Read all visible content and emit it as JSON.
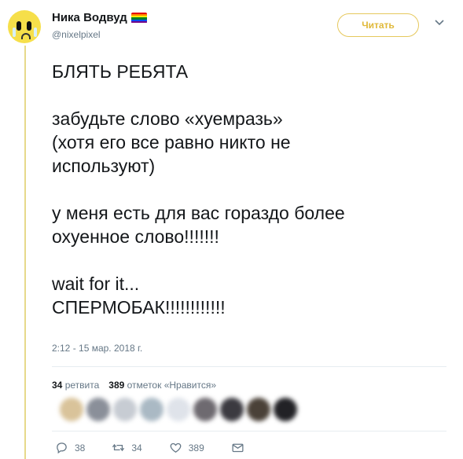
{
  "user": {
    "display_name": "Ника Водвуд",
    "handle": "@nixelpixel",
    "avatar_icon": "yellow-crying-face",
    "flag_icon": "rainbow-flag"
  },
  "header": {
    "follow_label": "Читать",
    "menu_icon": "chevron-down-icon"
  },
  "tweet": {
    "lines": [
      "БЛЯТЬ РЕБЯТА",
      "",
      "забудьте слово «хуемразь»",
      "(хотя его все равно никто не",
      "используют)",
      "",
      "у меня есть для вас гораздо более",
      "охуенное слово!!!!!!!",
      "",
      "wait for it...",
      "СПЕРМОБАК!!!!!!!!!!!!"
    ],
    "timestamp": "2:12 - 15 мар. 2018 г."
  },
  "stats": {
    "retweets_count": "34",
    "retweets_label": "ретвита",
    "likes_count": "389",
    "likes_label": "отметок «Нравится»"
  },
  "actions": {
    "reply_count": "38",
    "retweet_count": "34",
    "like_count": "389"
  },
  "colors": {
    "accent": "#e0b93a",
    "text": "#14171a",
    "secondary": "#657786"
  }
}
